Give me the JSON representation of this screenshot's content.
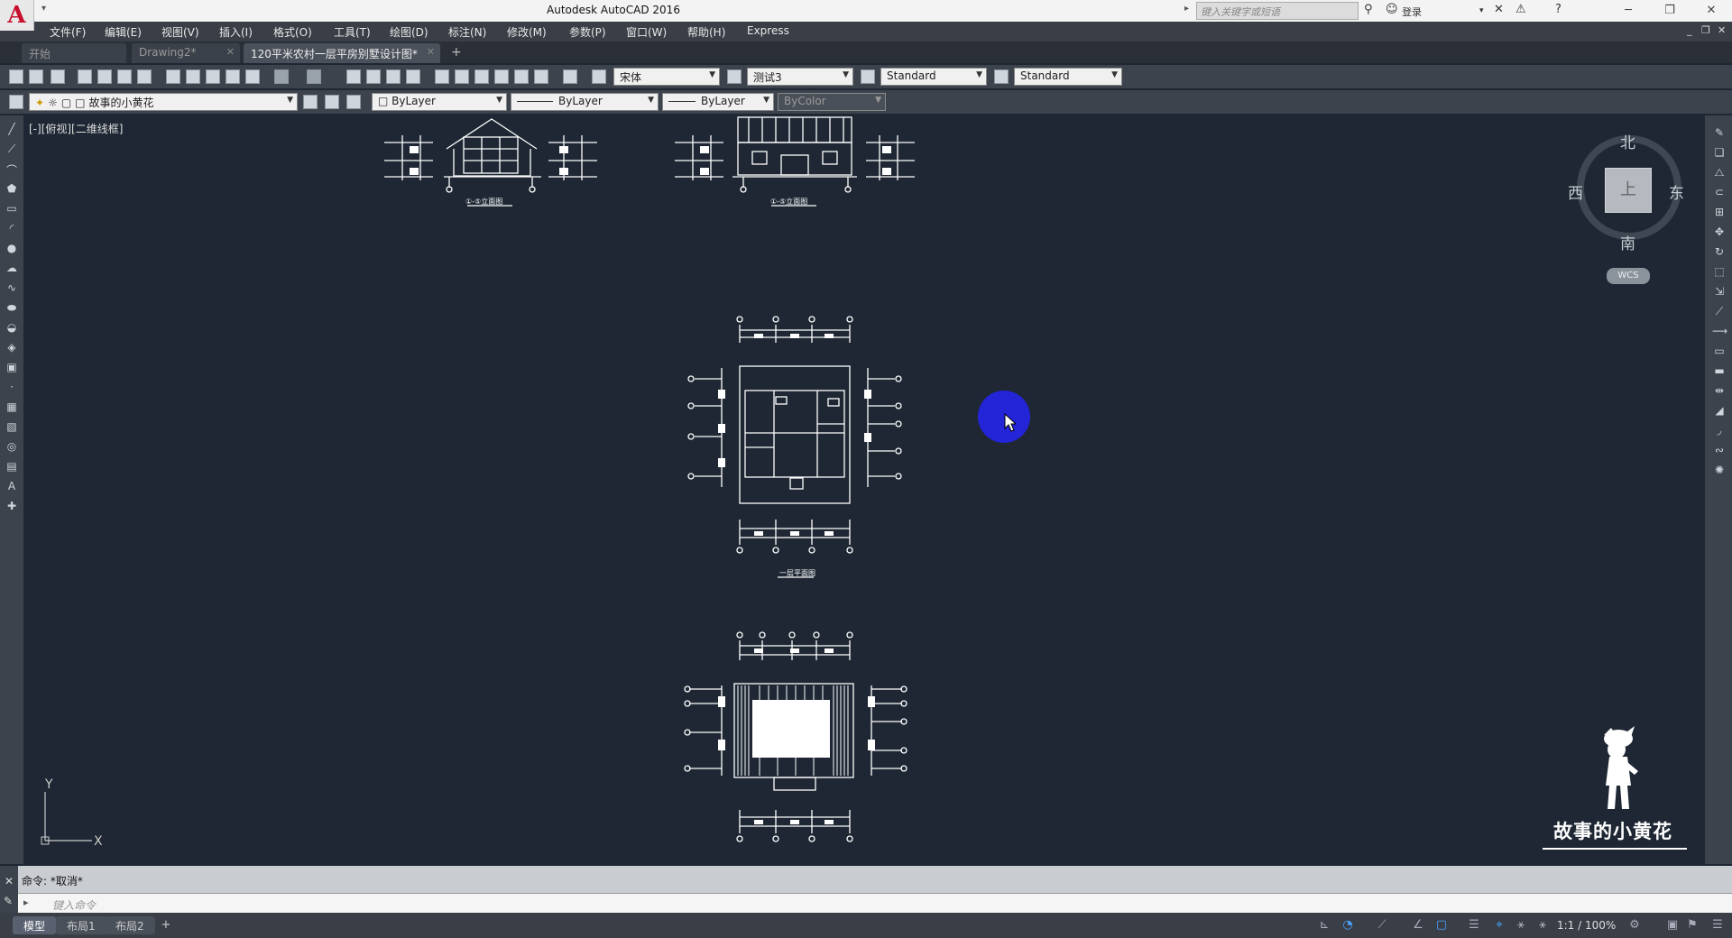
{
  "titlebar": {
    "title": "Autodesk AutoCAD 2016",
    "search_placeholder": "键入关键字或短语",
    "login_label": "登录"
  },
  "menu": [
    "文件(F)",
    "编辑(E)",
    "视图(V)",
    "插入(I)",
    "格式(O)",
    "工具(T)",
    "绘图(D)",
    "标注(N)",
    "修改(M)",
    "参数(P)",
    "窗口(W)",
    "帮助(H)",
    "Express"
  ],
  "tabs": [
    {
      "label": "开始",
      "active": false
    },
    {
      "label": "Drawing2*",
      "active": false
    },
    {
      "label": "120平米农村一层平房别墅设计图*",
      "active": true
    }
  ],
  "toolbar": {
    "font_combo": "宋体",
    "dim_style_combo": "测试3",
    "table_style_combo": "Standard",
    "mleader_style_combo": "Standard"
  },
  "layers": {
    "current_layer": "故事的小黄花",
    "color": "ByLayer",
    "linetype": "ByLayer",
    "lineweight": "ByLayer",
    "plotstyle": "ByColor"
  },
  "viewport": {
    "label": "[-][俯视][二维线框]",
    "drawing_captions": [
      "①-⑤立面图",
      "①-⑤立面图",
      "一层平面图"
    ]
  },
  "viewcube": {
    "north": "北",
    "south": "南",
    "east": "东",
    "west": "西",
    "top_face": "上",
    "wcs": "WCS"
  },
  "ucs": {
    "x_label": "X",
    "y_label": "Y"
  },
  "watermark": {
    "text": "故事的小黄花"
  },
  "command": {
    "history": "命令: *取消*",
    "placeholder": "键入命令"
  },
  "layout_tabs": [
    "模型",
    "布局1",
    "布局2"
  ],
  "status": {
    "scale": "1:1 / 100%"
  },
  "colors": {
    "canvas": "#1e2733",
    "drawing_lines": "#ffffff",
    "cursor_highlight": "#2424d8",
    "app_logo": "#c8102e"
  }
}
